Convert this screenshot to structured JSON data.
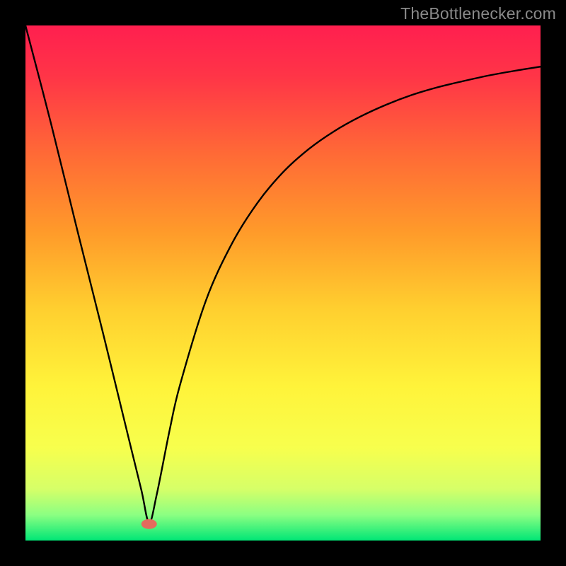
{
  "attribution": "TheBottlenecker.com",
  "chart_data": {
    "type": "line",
    "title": "",
    "xlabel": "",
    "ylabel": "",
    "xlim": [
      0,
      100
    ],
    "ylim": [
      0,
      100
    ],
    "x_of_min": 24,
    "series": [
      {
        "name": "curve",
        "x": [
          0,
          5,
          10,
          15,
          20,
          22.5,
          24,
          25.5,
          28,
          30,
          35,
          40,
          45,
          50,
          55,
          60,
          65,
          70,
          75,
          80,
          85,
          90,
          95,
          100
        ],
        "y": [
          100,
          80.8,
          60.5,
          40.5,
          20,
          9.8,
          3.5,
          9.0,
          21.5,
          30.2,
          46.5,
          57.5,
          65.5,
          71.5,
          76.0,
          79.5,
          82.3,
          84.6,
          86.5,
          88.0,
          89.2,
          90.3,
          91.2,
          92.0
        ]
      }
    ],
    "marker": {
      "x": 24,
      "y": 3.2
    },
    "gradient_stops": [
      {
        "offset": 0.0,
        "color": "#ff1f4f"
      },
      {
        "offset": 0.1,
        "color": "#ff3547"
      },
      {
        "offset": 0.25,
        "color": "#ff6a36"
      },
      {
        "offset": 0.4,
        "color": "#ff9a2a"
      },
      {
        "offset": 0.55,
        "color": "#ffcf2f"
      },
      {
        "offset": 0.7,
        "color": "#fff33a"
      },
      {
        "offset": 0.82,
        "color": "#f7ff4d"
      },
      {
        "offset": 0.9,
        "color": "#d6ff68"
      },
      {
        "offset": 0.95,
        "color": "#8cff82"
      },
      {
        "offset": 1.0,
        "color": "#00e676"
      }
    ],
    "colors": {
      "curve": "#000000",
      "marker": "#e46a5d",
      "frame": "#000000"
    }
  }
}
